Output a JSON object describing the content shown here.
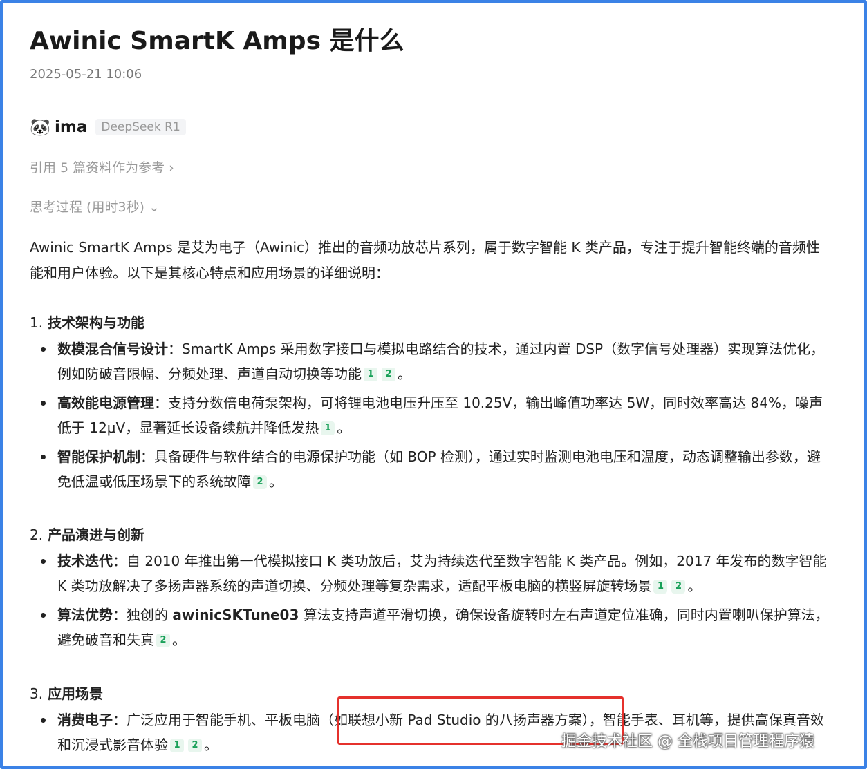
{
  "title": "Awinic SmartK Amps 是什么",
  "date": "2025-05-21 10:06",
  "author": {
    "avatar_icon": "panda-icon",
    "name": "ima",
    "model": "DeepSeek R1"
  },
  "references_label": "引用 5 篇资料作为参考",
  "thinking_label": "思考过程 (用时3秒)",
  "intro": "Awinic SmartK Amps 是艾为电子（Awinic）推出的音频功放芯片系列，属于数字智能 K 类产品，专注于提升智能终端的音频性能和用户体验。以下是其核心特点和应用场景的详细说明：",
  "sections": [
    {
      "number": "1.",
      "heading": "技术架构与功能",
      "items": [
        {
          "term": "数模混合信号设计",
          "text": "：SmartK Amps 采用数字接口与模拟电路结合的技术，通过内置 DSP（数字信号处理器）实现算法优化，例如防破音限幅、分频处理、声道自动切换等功能",
          "cite1": "1",
          "cite2": "2",
          "end": "。"
        },
        {
          "term": "高效能电源管理",
          "text": "：支持分数倍电荷泵架构，可将锂电池电压升压至 10.25V，输出峰值功率达 5W，同时效率高达 84%，噪声低于 12μV，显著延长设备续航并降低发热",
          "cite1": "1",
          "end": "。"
        },
        {
          "term": "智能保护机制",
          "text": "：具备硬件与软件结合的电源保护功能（如 BOP 检测），通过实时监测电池电压和温度，动态调整输出参数，避免低温或低压场景下的系统故障",
          "cite1": "2",
          "end": "。"
        }
      ]
    },
    {
      "number": "2.",
      "heading": "产品演进与创新",
      "items": [
        {
          "term": "技术迭代",
          "text": "：自 2010 年推出第一代模拟接口 K 类功放后，艾为持续迭代至数字智能 K 类产品。例如，2017 年发布的数字智能 K 类功放解决了多扬声器系统的声道切换、分频处理等复杂需求，适配平板电脑的横竖屏旋转场景",
          "cite1": "1",
          "cite2": "2",
          "end": "。"
        },
        {
          "term": "算法优势",
          "text_pre": "：独创的 ",
          "strong": "awinicSKTune03",
          "text": " 算法支持声道平滑切换，确保设备旋转时左右声道定位准确，同时内置喇叭保护算法，避免破音和失真",
          "cite1": "2",
          "end": "。"
        }
      ]
    },
    {
      "number": "3.",
      "heading": "应用场景",
      "items": [
        {
          "term": "消费电子",
          "text": "：广泛应用于智能手机、平板电脑（如联想小新 Pad Studio 的八扬声器方案），智能手表、耳机等，提供高保真音效和沉浸式影音体验",
          "cite1": "1",
          "cite2": "2",
          "end": "。"
        }
      ]
    }
  ],
  "watermark": "掘金技术社区 @ 全栈项目管理程序猿",
  "colors": {
    "frame_border": "#3b82e6",
    "highlight_box": "#e5312c",
    "cite_text": "#18a058",
    "cite_bg": "#e8f6ee"
  }
}
